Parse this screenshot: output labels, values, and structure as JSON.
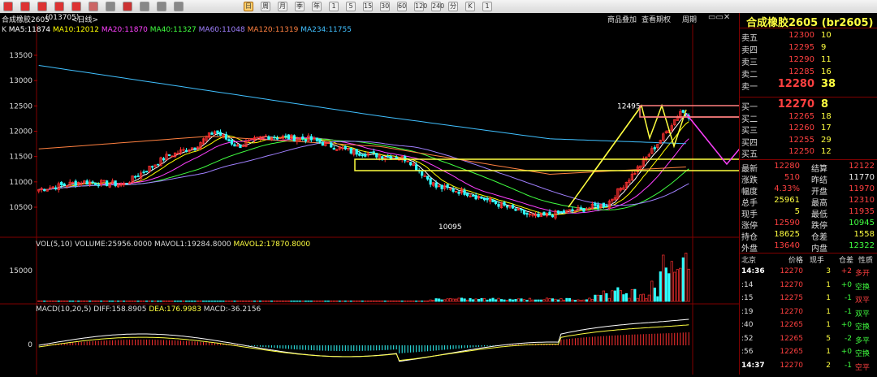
{
  "toolbar": {
    "icons": [
      "back-icon",
      "forward-icon",
      "stop-icon",
      "refresh-icon",
      "home-icon",
      "news-icon",
      "tools-icon",
      "filter-icon",
      "chart-icon",
      "draw-icon",
      "zoom-icon",
      "calendar-icon",
      "day-icon",
      "week-icon",
      "month-icon",
      "quarter-icon",
      "year-icon",
      "min1-icon",
      "min5-icon",
      "min15-icon",
      "min30-icon",
      "min60-icon",
      "min120-icon",
      "min240-icon",
      "min360-icon",
      "layout-icon"
    ],
    "buttons": [
      "日",
      "周",
      "月",
      "季",
      "年",
      "1",
      "5",
      "15",
      "30",
      "60",
      "120",
      "240",
      "分",
      "K",
      "1"
    ]
  },
  "title": {
    "instrument": "合成橡胶2605",
    "code": "(013705)",
    "period": "<日线>"
  },
  "tabs": {
    "intro": "商品叠加",
    "period_switch": "查看期权",
    "cycle": "周期"
  },
  "panel": {
    "title": "合成橡胶2605 (br2605)"
  },
  "ma": {
    "label": "K",
    "items": [
      {
        "name": "MA5:11874",
        "color": "#ffffff"
      },
      {
        "name": "MA10:12012",
        "color": "#ffff00"
      },
      {
        "name": "MA20:11870",
        "color": "#ff40ff"
      },
      {
        "name": "MA40:11327",
        "color": "#40ff40"
      },
      {
        "name": "MA60:11048",
        "color": "#a080ff"
      },
      {
        "name": "MA120:11319",
        "color": "#ff8040"
      },
      {
        "name": "MA234:11755",
        "color": "#40c0ff"
      }
    ]
  },
  "price_axis": [
    "13500",
    "13000",
    "12500",
    "12000",
    "11500",
    "11000",
    "10500"
  ],
  "annotations": {
    "high": "12495",
    "low": "10095"
  },
  "vol": {
    "label": "VOL(5,10)",
    "volume": "VOLUME:25956.0000",
    "mavol1": "MAVOL1:19284.8000",
    "mavol2": "MAVOL2:17870.8000",
    "axis": "15000"
  },
  "macd": {
    "label": "MACD(10,20,5)",
    "diff": "DIFF:158.8905",
    "dea": "DEA:176.9983",
    "macd": "MACD:-36.2156",
    "axis": "0"
  },
  "orderbook": {
    "asks": [
      {
        "label": "卖五",
        "price": "12300",
        "vol": "10"
      },
      {
        "label": "卖四",
        "price": "12295",
        "vol": "9"
      },
      {
        "label": "卖三",
        "price": "12290",
        "vol": "11"
      },
      {
        "label": "卖二",
        "price": "12285",
        "vol": "16"
      },
      {
        "label": "卖一",
        "price": "12280",
        "vol": "38"
      }
    ],
    "bids": [
      {
        "label": "买一",
        "price": "12270",
        "vol": "8"
      },
      {
        "label": "买二",
        "price": "12265",
        "vol": "18"
      },
      {
        "label": "买三",
        "price": "12260",
        "vol": "17"
      },
      {
        "label": "买四",
        "price": "12255",
        "vol": "29"
      },
      {
        "label": "买五",
        "price": "12250",
        "vol": "12"
      }
    ]
  },
  "stats": [
    {
      "l1": "最新",
      "v1": "12280",
      "c1": "#ff4040",
      "l2": "结算",
      "v2": "12122",
      "c2": "#ff4040"
    },
    {
      "l1": "涨跌",
      "v1": "510",
      "c1": "#ff4040",
      "l2": "昨结",
      "v2": "11770",
      "c2": "#eeeeee"
    },
    {
      "l1": "幅度",
      "v1": "4.33%",
      "c1": "#ff4040",
      "l2": "开盘",
      "v2": "11970",
      "c2": "#ff4040"
    },
    {
      "l1": "总手",
      "v1": "25961",
      "c1": "#ffff40",
      "l2": "最高",
      "v2": "12310",
      "c2": "#ff4040"
    },
    {
      "l1": "现手",
      "v1": "5",
      "c1": "#ffff40",
      "l2": "最低",
      "v2": "11935",
      "c2": "#ff4040"
    },
    {
      "l1": "涨停",
      "v1": "12590",
      "c1": "#ff4040",
      "l2": "跌停",
      "v2": "10945",
      "c2": "#40ff40"
    },
    {
      "l1": "持仓",
      "v1": "18625",
      "c1": "#ffff40",
      "l2": "仓差",
      "v2": "1558",
      "c2": "#ffff40"
    },
    {
      "l1": "外盘",
      "v1": "13640",
      "c1": "#ff4040",
      "l2": "内盘",
      "v2": "12322",
      "c2": "#40ff40"
    }
  ],
  "ticks_header": {
    "place": "北京",
    "price": "价格",
    "now": "现手",
    "chg": "仓差",
    "nature": "性质"
  },
  "ticks": [
    {
      "t": "14:36",
      "p": "12270",
      "pc": "#ff4040",
      "v": "3",
      "c": "+2",
      "cc": "#ff4040",
      "n": "多开",
      "nc": "#ff4040"
    },
    {
      "t": ":14",
      "p": "12270",
      "pc": "#ff4040",
      "v": "1",
      "c": "+0",
      "cc": "#40ff40",
      "n": "空换",
      "nc": "#40ff40"
    },
    {
      "t": ":15",
      "p": "12275",
      "pc": "#ff4040",
      "v": "1",
      "c": "-1",
      "cc": "#40ff40",
      "n": "双平",
      "nc": "#ff4040"
    },
    {
      "t": ":19",
      "p": "12270",
      "pc": "#ff4040",
      "v": "1",
      "c": "-1",
      "cc": "#40ff40",
      "n": "双平",
      "nc": "#40ff40"
    },
    {
      "t": ":40",
      "p": "12265",
      "pc": "#ff4040",
      "v": "1",
      "c": "+0",
      "cc": "#40ff40",
      "n": "空换",
      "nc": "#40ff40"
    },
    {
      "t": ":52",
      "p": "12265",
      "pc": "#ff4040",
      "v": "5",
      "c": "-2",
      "cc": "#40ff40",
      "n": "多平",
      "nc": "#40ff40"
    },
    {
      "t": ":56",
      "p": "12265",
      "pc": "#ff4040",
      "v": "1",
      "c": "+0",
      "cc": "#40ff40",
      "n": "空换",
      "nc": "#40ff40"
    },
    {
      "t": "14:37",
      "p": "12270",
      "pc": "#ff4040",
      "v": "2",
      "c": "-1",
      "cc": "#40ff40",
      "n": "空平",
      "nc": "#ff4040"
    }
  ]
}
